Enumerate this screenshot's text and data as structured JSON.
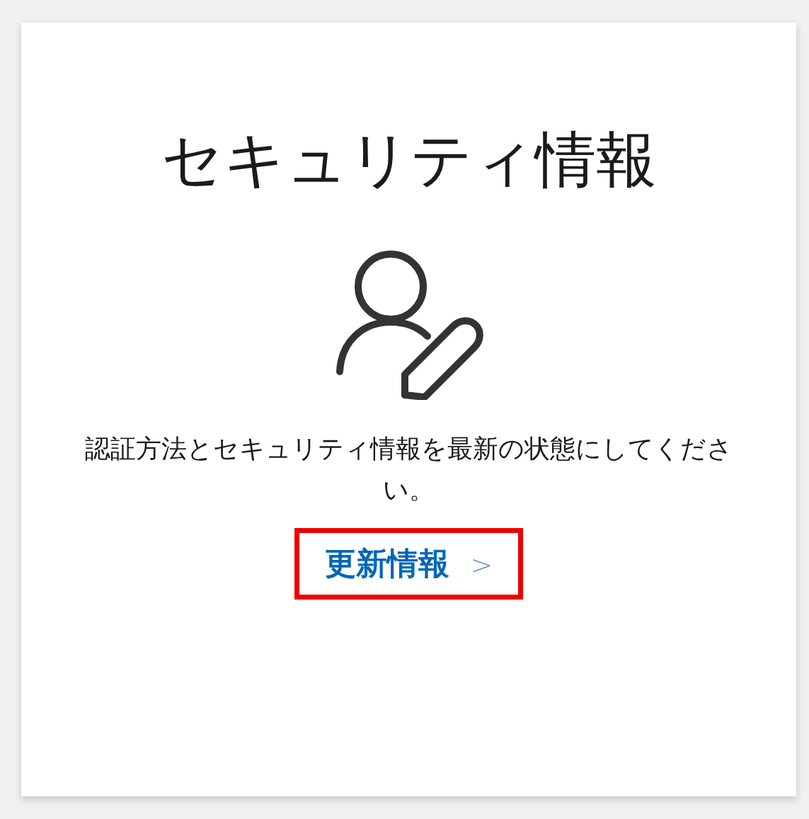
{
  "card": {
    "title": "セキュリティ情報",
    "description": "認証方法とセキュリティ情報を最新の状態にしてください。",
    "link": {
      "label": "更新情報",
      "chevron": ">",
      "highlighted": true
    }
  }
}
